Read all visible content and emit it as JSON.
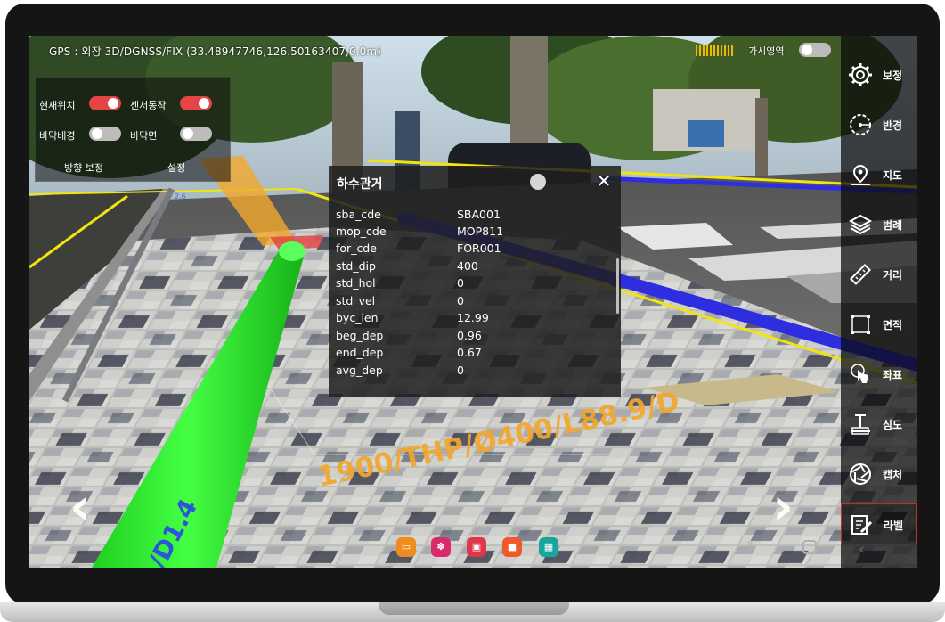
{
  "status_bar": {
    "gps_text": "GPS : 외장 3D/DGNSS/FIX (33.48947746,126.50163407,0.0m)",
    "visible_area_label": "가시영역",
    "visible_area_on": false
  },
  "settings_panel": {
    "current_location_label": "현재위치",
    "current_location_on": true,
    "sensor_label": "센서동작",
    "sensor_on": true,
    "floor_bg_label": "바닥배경",
    "floor_bg_on": false,
    "floor_plane_label": "바닥면",
    "floor_plane_on": false,
    "direction_calibrate_label": "방향 보정",
    "settings_label": "설정"
  },
  "info_popup": {
    "title": "하수관거",
    "rows": [
      {
        "key": "sba_cde",
        "value": "SBA001"
      },
      {
        "key": "mop_cde",
        "value": "MOP811"
      },
      {
        "key": "for_cde",
        "value": "FOR001"
      },
      {
        "key": "std_dip",
        "value": "400"
      },
      {
        "key": "std_hol",
        "value": "0"
      },
      {
        "key": "std_vel",
        "value": "0"
      },
      {
        "key": "byc_len",
        "value": "12.99"
      },
      {
        "key": "beg_dep",
        "value": "0.96"
      },
      {
        "key": "end_dep",
        "value": "0.67"
      },
      {
        "key": "avg_dep",
        "value": "0"
      }
    ]
  },
  "ar_labels": {
    "pipe_label": "1900/THP/Ø400/L88.9/D",
    "green_pipe_label": "/D1.4"
  },
  "side_menu": [
    {
      "label": "보정",
      "icon": "gear-icon"
    },
    {
      "label": "반경",
      "icon": "radius-icon"
    },
    {
      "label": "지도",
      "icon": "map-pin-icon"
    },
    {
      "label": "범례",
      "icon": "layers-icon"
    },
    {
      "label": "거리",
      "icon": "ruler-icon"
    },
    {
      "label": "면적",
      "icon": "area-icon"
    },
    {
      "label": "좌표",
      "icon": "coordinate-touch-icon"
    },
    {
      "label": "심도",
      "icon": "depth-icon"
    },
    {
      "label": "캡처",
      "icon": "camera-shutter-icon"
    },
    {
      "label": "라벨",
      "icon": "label-icon",
      "active": true
    }
  ],
  "colors": {
    "toggle_on": "#e54545",
    "toggle_off": "#bcbcbc",
    "active_menu_border": "#b8322c",
    "green_pipe": "#2bea2b",
    "blue_pipe": "#2e2ee0",
    "yellow_line": "#f2e411",
    "orange_label": "#f2a72c",
    "signal": "#f2b800"
  }
}
